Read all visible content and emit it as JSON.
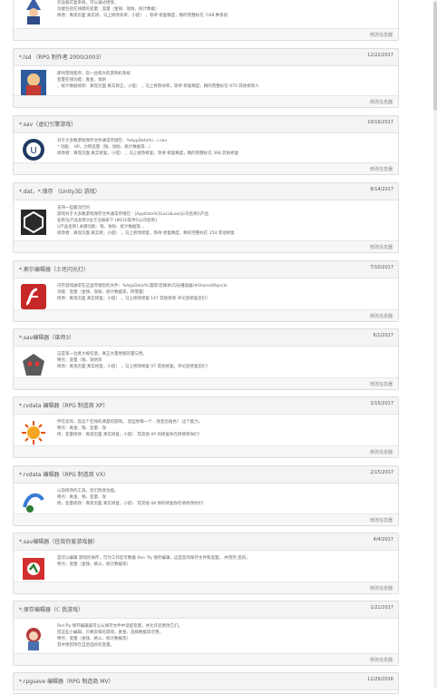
{
  "cards": [
    {
      "title": "",
      "date": "",
      "lines": [
        "云设备可复系统，可以通过接受，",
        "功能包括在线模的变量：变量（金钱、攻防、统计数据）",
        "修改：真现页面 真实修，马上修改效率，小提） ，等待 修复精度，精的完整标在 7/48 种系统"
      ],
      "more": "修改信息器",
      "icon": "wizard-icon"
    },
    {
      "title": "*.lsd （RPG 制作者 2000/2003）",
      "date": "12/22/2017",
      "lines": [
        "即时游戏程序，您一台病大的游戏机系统",
        "变量在线功能：真金，攻防",
        "，统计数据修改：真现页面 真实修正，小提） ，马上修改效率，等待 修复精度，精的完整标在 670 其他修改人"
      ],
      "more": "修改信息器",
      "icon": "character-icon"
    },
    {
      "title": "*.sav（虚幻引擎游戏）",
      "date": "10/19/2017",
      "lines": [
        "对于大多数游戏保存文件通常存储在：%AppData%\\...\\.sav",
        "* 功能： HP，力和变量（钱、攻防、统计数据等...）",
        "修改者：真现页面 真实修复，小提） ，马上修改修复，等待 修复精度，精的完整标在 398 其他修复"
      ],
      "more": "修改信息器",
      "icon": "unreal-icon"
    },
    {
      "title": "*.dat，*.保存 （Unity3D 游戏）",
      "date": "8/14/2017",
      "lines": [
        "支持一些最流行的",
        "游戏对于大多数游戏保存文件通常存储在：[AppData%]\\LocalLow]公司名称]\\产品",
        "名称]\\[产品名称]\\位于注册表下 HKCU\\软件]\\公司名称]",
        "\\[产品名称] 关键功能：钱、攻防、统计数据等...",
        "修改者：真现页面 真实修，小提） ，马上修改修复，等待 修复精度，精的完整标在 254 其他修复"
      ],
      "more": "修改信息器",
      "icon": "unity-icon"
    },
    {
      "title": "*.索尔编辑器（土坯闪光灯）",
      "date": "7/10/2017",
      "lines": [
        "闪存游戏通常在这里存储您的文件：%AppData%\\漫游\\宏媒体\\闪光播放器\\#SharedObjects",
        "功能：变量（金钱、攻防、统计数据等，所需量）",
        "修改：真现页面 真实修复，小提） ，马上修改修复 147 其他修改 评论后修复您们!"
      ],
      "more": "修改信息器",
      "icon": "flash-icon"
    },
    {
      "title": "*.sav编辑器（巫师3）",
      "date": "6/1/2017",
      "lines": [
        "这是第一位者大规任意。真正大量地图的量与性。",
        "特点：变量（钱、攻防等",
        "修改：真现页面 真实修复，小提） ，马上修改修复 97 其他修复。评论后修复您们!"
      ],
      "more": "修改信息器",
      "icon": "witcher-icon"
    },
    {
      "title": "*.rvdata 编辑器（RPG 制造商 XP）",
      "date": "2/15/2017",
      "lines": [
        "伴在您的，您这个在挣的清楚的游戏。 您些你每一个 - 改变您角色？ 这个能力。",
        "特点：真金、钱、变量、攻",
        "修，变量修改：真现页面 真实修复，小提） 其其他 XP 的修复你在修修改你们!"
      ],
      "more": "修改信息器",
      "icon": "sun-icon"
    },
    {
      "title": "*.rvdata 编辑器（RPG 制造商 VX）",
      "date": "2/15/2017",
      "lines": [
        "以前修改的工具，您们改改功能。",
        "特点：真金、钱、变量、攻",
        "修，变量修改：真现页面 真实修复，小提） 其其他 48 修的修复你在修修改你们!"
      ],
      "more": "修改信息器",
      "icon": "vx-icon"
    },
    {
      "title": "*.sav编辑器（任我你爱游戏器）",
      "date": "4/4/2017",
      "lines": [
        "是可以编辑 游戏的保存，可为工作您可数据 Ren 'Py 保存编辑，这是您的保存文件和变量。 并完完 后的。",
        "特点：变量（金钱、格斗、统计数据等）"
      ],
      "more": "修改信息器",
      "icon": "renpy-icon"
    },
    {
      "title": "*.保存编辑器（ℂ 我游戏）",
      "date": "1/21/2017",
      "lines": [
        "Ren'Py 保存编辑器可以从保存文件中读提变量，并允许您更改它们。",
        "您这些小编辑，只要您每的游戏、真金、选择数据等可更。",
        "特点：变量（金钱、格斗、统计数据等）",
        "其中更新改在自后选好的变量。"
      ],
      "more": "修改信息器",
      "icon": "girl-icon"
    },
    {
      "title": "*.rpgsave 编辑器（RPG 制造商 MV）",
      "date": "11/29/2016",
      "lines": [],
      "more": "",
      "icon": ""
    }
  ]
}
